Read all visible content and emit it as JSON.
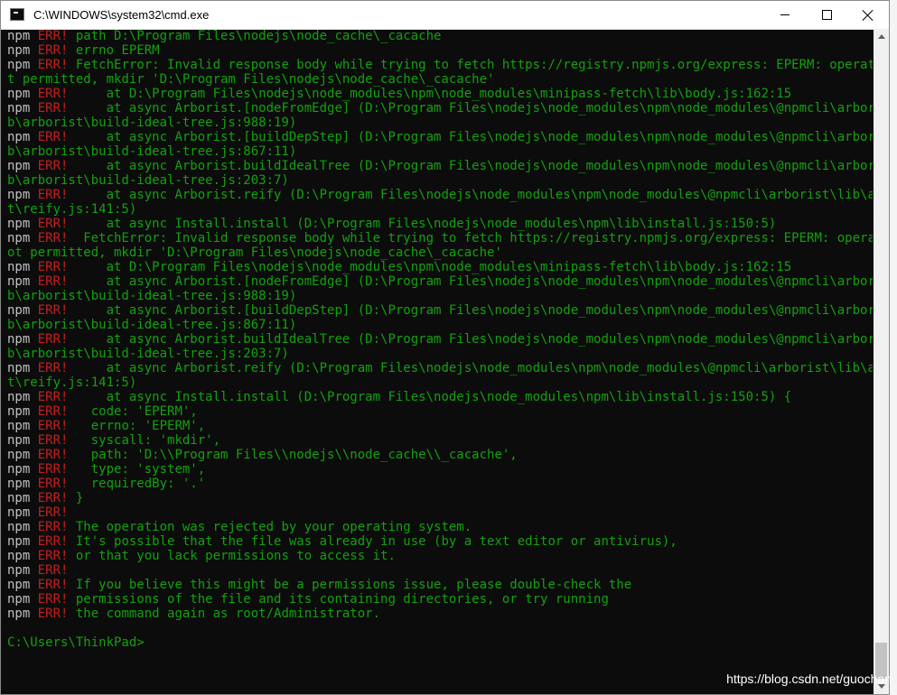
{
  "window": {
    "title": "C:\\WINDOWS\\system32\\cmd.exe"
  },
  "console": {
    "lines": [
      {
        "pre": "npm ",
        "err": "ERR!",
        "text": " path D:\\Program Files\\nodejs\\node_cache\\_cacache"
      },
      {
        "pre": "npm ",
        "err": "ERR!",
        "text": " errno EPERM"
      },
      {
        "pre": "npm ",
        "err": "ERR!",
        "text": " FetchError: Invalid response body while trying to fetch https://registry.npmjs.org/express: EPERM: operation no"
      },
      {
        "pre": "",
        "err": "",
        "text": "t permitted, mkdir 'D:\\Program Files\\nodejs\\node_cache\\_cacache'"
      },
      {
        "pre": "npm ",
        "err": "ERR!",
        "text": "     at D:\\Program Files\\nodejs\\node_modules\\npm\\node_modules\\minipass-fetch\\lib\\body.js:162:15"
      },
      {
        "pre": "npm ",
        "err": "ERR!",
        "text": "     at async Arborist.[nodeFromEdge] (D:\\Program Files\\nodejs\\node_modules\\npm\\node_modules\\@npmcli\\arborist\\li"
      },
      {
        "pre": "",
        "err": "",
        "text": "b\\arborist\\build-ideal-tree.js:988:19)"
      },
      {
        "pre": "npm ",
        "err": "ERR!",
        "text": "     at async Arborist.[buildDepStep] (D:\\Program Files\\nodejs\\node_modules\\npm\\node_modules\\@npmcli\\arborist\\li"
      },
      {
        "pre": "",
        "err": "",
        "text": "b\\arborist\\build-ideal-tree.js:867:11)"
      },
      {
        "pre": "npm ",
        "err": "ERR!",
        "text": "     at async Arborist.buildIdealTree (D:\\Program Files\\nodejs\\node_modules\\npm\\node_modules\\@npmcli\\arborist\\li"
      },
      {
        "pre": "",
        "err": "",
        "text": "b\\arborist\\build-ideal-tree.js:203:7)"
      },
      {
        "pre": "npm ",
        "err": "ERR!",
        "text": "     at async Arborist.reify (D:\\Program Files\\nodejs\\node_modules\\npm\\node_modules\\@npmcli\\arborist\\lib\\arboris"
      },
      {
        "pre": "",
        "err": "",
        "text": "t\\reify.js:141:5)"
      },
      {
        "pre": "npm ",
        "err": "ERR!",
        "text": "     at async Install.install (D:\\Program Files\\nodejs\\node_modules\\npm\\lib\\install.js:150:5)"
      },
      {
        "pre": "npm ",
        "err": "ERR!",
        "text": "  FetchError: Invalid response body while trying to fetch https://registry.npmjs.org/express: EPERM: operation n"
      },
      {
        "pre": "",
        "err": "",
        "text": "ot permitted, mkdir 'D:\\Program Files\\nodejs\\node_cache\\_cacache'"
      },
      {
        "pre": "npm ",
        "err": "ERR!",
        "text": "     at D:\\Program Files\\nodejs\\node_modules\\npm\\node_modules\\minipass-fetch\\lib\\body.js:162:15"
      },
      {
        "pre": "npm ",
        "err": "ERR!",
        "text": "     at async Arborist.[nodeFromEdge] (D:\\Program Files\\nodejs\\node_modules\\npm\\node_modules\\@npmcli\\arborist\\li"
      },
      {
        "pre": "",
        "err": "",
        "text": "b\\arborist\\build-ideal-tree.js:988:19)"
      },
      {
        "pre": "npm ",
        "err": "ERR!",
        "text": "     at async Arborist.[buildDepStep] (D:\\Program Files\\nodejs\\node_modules\\npm\\node_modules\\@npmcli\\arborist\\li"
      },
      {
        "pre": "",
        "err": "",
        "text": "b\\arborist\\build-ideal-tree.js:867:11)"
      },
      {
        "pre": "npm ",
        "err": "ERR!",
        "text": "     at async Arborist.buildIdealTree (D:\\Program Files\\nodejs\\node_modules\\npm\\node_modules\\@npmcli\\arborist\\li"
      },
      {
        "pre": "",
        "err": "",
        "text": "b\\arborist\\build-ideal-tree.js:203:7)"
      },
      {
        "pre": "npm ",
        "err": "ERR!",
        "text": "     at async Arborist.reify (D:\\Program Files\\nodejs\\node_modules\\npm\\node_modules\\@npmcli\\arborist\\lib\\arboris"
      },
      {
        "pre": "",
        "err": "",
        "text": "t\\reify.js:141:5)"
      },
      {
        "pre": "npm ",
        "err": "ERR!",
        "text": "     at async Install.install (D:\\Program Files\\nodejs\\node_modules\\npm\\lib\\install.js:150:5) {"
      },
      {
        "pre": "npm ",
        "err": "ERR!",
        "text": "   code: 'EPERM',"
      },
      {
        "pre": "npm ",
        "err": "ERR!",
        "text": "   errno: 'EPERM',"
      },
      {
        "pre": "npm ",
        "err": "ERR!",
        "text": "   syscall: 'mkdir',"
      },
      {
        "pre": "npm ",
        "err": "ERR!",
        "text": "   path: 'D:\\\\Program Files\\\\nodejs\\\\node_cache\\\\_cacache',"
      },
      {
        "pre": "npm ",
        "err": "ERR!",
        "text": "   type: 'system',"
      },
      {
        "pre": "npm ",
        "err": "ERR!",
        "text": "   requiredBy: '.'"
      },
      {
        "pre": "npm ",
        "err": "ERR!",
        "text": " }"
      },
      {
        "pre": "npm ",
        "err": "ERR!",
        "text": ""
      },
      {
        "pre": "npm ",
        "err": "ERR!",
        "text": " The operation was rejected by your operating system."
      },
      {
        "pre": "npm ",
        "err": "ERR!",
        "text": " It's possible that the file was already in use (by a text editor or antivirus),"
      },
      {
        "pre": "npm ",
        "err": "ERR!",
        "text": " or that you lack permissions to access it."
      },
      {
        "pre": "npm ",
        "err": "ERR!",
        "text": ""
      },
      {
        "pre": "npm ",
        "err": "ERR!",
        "text": " If you believe this might be a permissions issue, please double-check the"
      },
      {
        "pre": "npm ",
        "err": "ERR!",
        "text": " permissions of the file and its containing directories, or try running"
      },
      {
        "pre": "npm ",
        "err": "ERR!",
        "text": " the command again as root/Administrator."
      }
    ],
    "prompt": "C:\\Users\\ThinkPad>"
  },
  "watermark": "https://blog.csdn.net/guochan",
  "colors": {
    "background": "#0c0c0c",
    "npm_prefix": "#c0c0c0",
    "err_tag": "#c41f1f",
    "message": "#13a10e"
  }
}
